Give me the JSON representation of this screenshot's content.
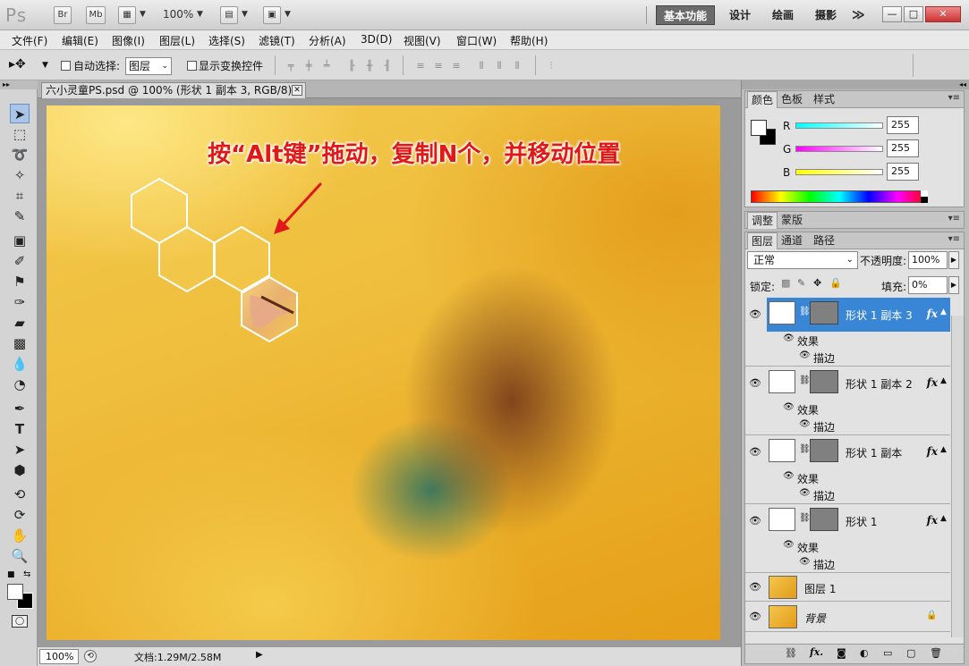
{
  "app": {
    "logo": "Ps",
    "bridge": "Br",
    "minibridge": "Mb",
    "zoom": "100%",
    "workspaces": [
      "基本功能",
      "设计",
      "绘画",
      "摄影"
    ],
    "more": "≫",
    "win_min": "—",
    "win_max": "□",
    "win_close": "✕"
  },
  "menu": [
    "文件(F)",
    "编辑(E)",
    "图像(I)",
    "图层(L)",
    "选择(S)",
    "滤镜(T)",
    "分析(A)",
    "3D(D)",
    "视图(V)",
    "窗口(W)",
    "帮助(H)"
  ],
  "options": {
    "auto_select_label": "自动选择:",
    "auto_select_value": "图层",
    "show_transform_label": "显示变换控件"
  },
  "document": {
    "tab_title": "六小灵童PS.psd @ 100% (形状 1 副本 3, RGB/8) *",
    "annotation": "按“Alt键”拖动，复制N个，并移动位置",
    "status_zoom": "100%",
    "doc_size": "文档:1.29M/2.58M"
  },
  "color_panel": {
    "tabs": [
      "颜色",
      "色板",
      "样式"
    ],
    "channels": [
      {
        "label": "R",
        "value": "255"
      },
      {
        "label": "G",
        "value": "255"
      },
      {
        "label": "B",
        "value": "255"
      }
    ]
  },
  "adjust_panel": {
    "tabs": [
      "调整",
      "蒙版"
    ]
  },
  "layers_panel": {
    "tabs": [
      "图层",
      "通道",
      "路径"
    ],
    "blend_mode": "正常",
    "opacity_label": "不透明度:",
    "opacity": "100%",
    "lock_label": "锁定:",
    "fill_label": "填充:",
    "fill": "0%",
    "effects_label": "效果",
    "stroke_label": "描边",
    "fx_label": "fx",
    "layers": [
      {
        "name": "形状 1 副本 3",
        "selected": true
      },
      {
        "name": "形状 1 副本 2",
        "selected": false
      },
      {
        "name": "形状 1 副本",
        "selected": false
      },
      {
        "name": "形状 1",
        "selected": false
      }
    ],
    "image_layer": "图层 1",
    "background_layer": "背景"
  },
  "colors": {
    "selected_layer": "#3a86d6",
    "annotation": "#e01818"
  }
}
